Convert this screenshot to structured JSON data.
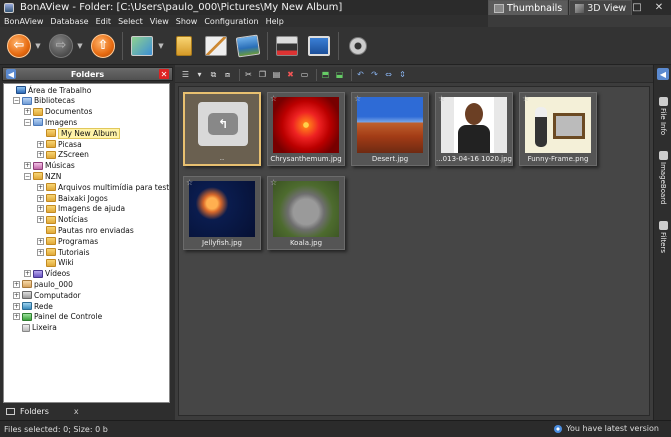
{
  "window": {
    "title": "BonAView - Folder: [C:\\Users\\paulo_000\\Pictures\\My New Album]",
    "view_tabs": [
      {
        "label": "Thumbnails",
        "active": true
      },
      {
        "label": "3D View",
        "active": false
      }
    ],
    "controls": {
      "minimize": "–",
      "maximize": "□",
      "close": "✕"
    }
  },
  "menu": [
    "BonAView",
    "Database",
    "Edit",
    "Select",
    "View",
    "Show",
    "Configuration",
    "Help"
  ],
  "toolbar": {
    "back_glyph": "⇦",
    "forward_glyph": "⇨",
    "up_glyph": "⇧",
    "dropdown_glyph": "▼"
  },
  "folders_panel": {
    "title": "Folders",
    "pin_glyph": "◀",
    "close_glyph": "✕",
    "tree": [
      {
        "label": "Área de Trabalho",
        "level": 0,
        "icon": "desk",
        "expander": "none"
      },
      {
        "label": "Bibliotecas",
        "level": 1,
        "icon": "lib",
        "expander": "−"
      },
      {
        "label": "Documentos",
        "level": 2,
        "icon": "folder",
        "expander": "+"
      },
      {
        "label": "Imagens",
        "level": 2,
        "icon": "lib",
        "expander": "−"
      },
      {
        "label": "My New Album",
        "level": 3,
        "icon": "folder",
        "expander": "none",
        "selected": true
      },
      {
        "label": "Picasa",
        "level": 3,
        "icon": "folder",
        "expander": "+"
      },
      {
        "label": "ZScreen",
        "level": 3,
        "icon": "folder",
        "expander": "+"
      },
      {
        "label": "Músicas",
        "level": 2,
        "icon": "music",
        "expander": "+"
      },
      {
        "label": "NZN",
        "level": 2,
        "icon": "folder",
        "expander": "−"
      },
      {
        "label": "Arquivos multimídia para teste",
        "level": 3,
        "icon": "folder",
        "expander": "+"
      },
      {
        "label": "Baixaki Jogos",
        "level": 3,
        "icon": "folder",
        "expander": "+"
      },
      {
        "label": "Imagens de ajuda",
        "level": 3,
        "icon": "folder",
        "expander": "+"
      },
      {
        "label": "Notícias",
        "level": 3,
        "icon": "folder",
        "expander": "+"
      },
      {
        "label": "Pautas nro enviadas",
        "level": 3,
        "icon": "folder",
        "expander": "none"
      },
      {
        "label": "Programas",
        "level": 3,
        "icon": "folder",
        "expander": "+"
      },
      {
        "label": "Tutoriais",
        "level": 3,
        "icon": "folder",
        "expander": "+"
      },
      {
        "label": "Wiki",
        "level": 3,
        "icon": "folder",
        "expander": "none"
      },
      {
        "label": "Vídeos",
        "level": 2,
        "icon": "vid",
        "expander": "+"
      },
      {
        "label": "paulo_000",
        "level": 1,
        "icon": "user",
        "expander": "+"
      },
      {
        "label": "Computador",
        "level": 1,
        "icon": "comp",
        "expander": "+"
      },
      {
        "label": "Rede",
        "level": 1,
        "icon": "net",
        "expander": "+"
      },
      {
        "label": "Painel de Controle",
        "level": 1,
        "icon": "ctrl",
        "expander": "+"
      },
      {
        "label": "Lixeira",
        "level": 1,
        "icon": "trash",
        "expander": "none"
      }
    ],
    "bottom_tab": {
      "label": "Folders",
      "close": "x"
    }
  },
  "thumbnails": [
    {
      "caption": "..",
      "kind": "folderup",
      "selected": true,
      "star": ""
    },
    {
      "caption": "Chrysanthemum.jpg",
      "kind": "flower",
      "star": "☆"
    },
    {
      "caption": "Desert.jpg",
      "kind": "desert",
      "star": "☆"
    },
    {
      "caption": "...013-04-16 1020.jpg",
      "kind": "portrait",
      "star": "☆"
    },
    {
      "caption": "Funny-Frame.png",
      "kind": "funny",
      "star": "☆"
    },
    {
      "caption": "Jellyfish.jpg",
      "kind": "jelly",
      "star": "☆"
    },
    {
      "caption": "Koala.jpg",
      "kind": "koala",
      "star": "☆"
    }
  ],
  "right_panel": {
    "collapse_glyph": "◀",
    "tabs": [
      "File Info",
      "ImageBoard",
      "Filters"
    ]
  },
  "status": {
    "left": "Files selected: 0; Size: 0 b",
    "right": "You have latest version"
  }
}
